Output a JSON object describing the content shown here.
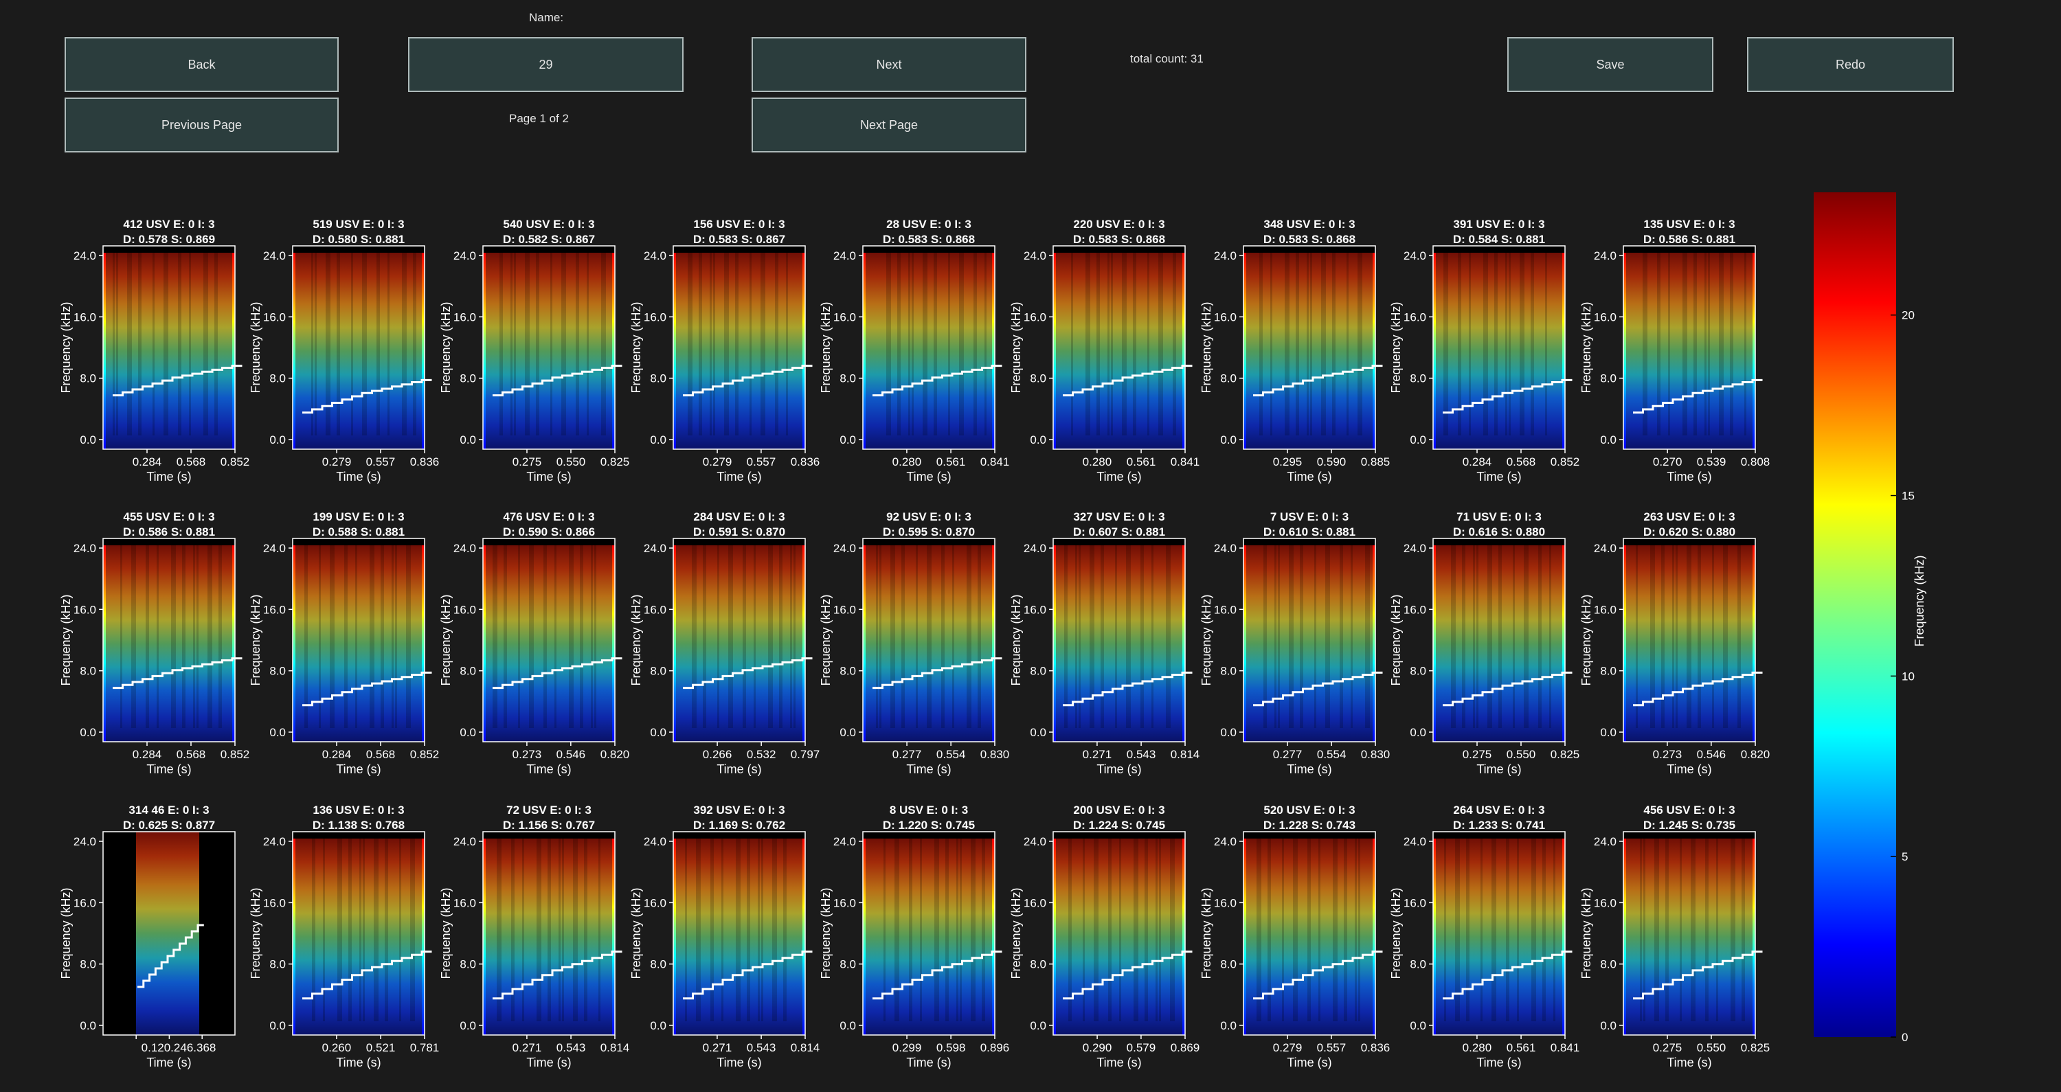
{
  "toolbar": {
    "back_label": "Back",
    "name_label": "Name:",
    "name_value": "29",
    "next_label": "Next",
    "total_count": "total count: 31",
    "save_label": "Save",
    "redo_label": "Redo",
    "prev_page_label": "Previous Page",
    "page_indicator": "Page 1 of 2",
    "next_page_label": "Next Page"
  },
  "axis_text": {
    "ylabel": "Frequency (kHz)",
    "xlabel": "Time (s)"
  },
  "colorbar": {
    "label": "Frequency (kHz)",
    "ticks": [
      "0",
      "5",
      "10",
      "15",
      "20"
    ],
    "range": [
      0,
      23.4
    ]
  },
  "chart_data": [
    {
      "type": "heatmap",
      "title1": "412 USV E: 0 I: 3",
      "title2": "D: 0.578  S: 0.869",
      "yticks": [
        "0.0",
        "8.0",
        "16.0",
        "24.0"
      ],
      "xticks": [
        "0.284",
        "0.568",
        "0.852"
      ],
      "xmax": 0.852
    },
    {
      "type": "heatmap",
      "title1": "519 USV E: 0 I: 3",
      "title2": "D: 0.580  S: 0.881",
      "yticks": [
        "0.0",
        "8.0",
        "16.0",
        "24.0"
      ],
      "xticks": [
        "0.279",
        "0.557",
        "0.836"
      ],
      "xmax": 0.836
    },
    {
      "type": "heatmap",
      "title1": "540 USV E: 0 I: 3",
      "title2": "D: 0.582  S: 0.867",
      "yticks": [
        "0.0",
        "8.0",
        "16.0",
        "24.0"
      ],
      "xticks": [
        "0.275",
        "0.550",
        "0.825"
      ],
      "xmax": 0.825
    },
    {
      "type": "heatmap",
      "title1": "156 USV E: 0 I: 3",
      "title2": "D: 0.583  S: 0.867",
      "yticks": [
        "0.0",
        "8.0",
        "16.0",
        "24.0"
      ],
      "xticks": [
        "0.279",
        "0.557",
        "0.836"
      ],
      "xmax": 0.836
    },
    {
      "type": "heatmap",
      "title1": "28 USV E: 0 I: 3",
      "title2": "D: 0.583  S: 0.868",
      "yticks": [
        "0.0",
        "8.0",
        "16.0",
        "24.0"
      ],
      "xticks": [
        "0.280",
        "0.561",
        "0.841"
      ],
      "xmax": 0.841
    },
    {
      "type": "heatmap",
      "title1": "220 USV E: 0 I: 3",
      "title2": "D: 0.583  S: 0.868",
      "yticks": [
        "0.0",
        "8.0",
        "16.0",
        "24.0"
      ],
      "xticks": [
        "0.280",
        "0.561",
        "0.841"
      ],
      "xmax": 0.841
    },
    {
      "type": "heatmap",
      "title1": "348 USV E: 0 I: 3",
      "title2": "D: 0.583  S: 0.868",
      "yticks": [
        "0.0",
        "8.0",
        "16.0",
        "24.0"
      ],
      "xticks": [
        "0.295",
        "0.590",
        "0.885"
      ],
      "xmax": 0.885
    },
    {
      "type": "heatmap",
      "title1": "391 USV E: 0 I: 3",
      "title2": "D: 0.584  S: 0.881",
      "yticks": [
        "0.0",
        "8.0",
        "16.0",
        "24.0"
      ],
      "xticks": [
        "0.284",
        "0.568",
        "0.852"
      ],
      "xmax": 0.852
    },
    {
      "type": "heatmap",
      "title1": "135 USV E: 0 I: 3",
      "title2": "D: 0.586  S: 0.881",
      "yticks": [
        "0.0",
        "8.0",
        "16.0",
        "24.0"
      ],
      "xticks": [
        "0.270",
        "0.539",
        "0.808"
      ],
      "xmax": 0.808
    },
    {
      "type": "heatmap",
      "title1": "455 USV E: 0 I: 3",
      "title2": "D: 0.586  S: 0.881",
      "yticks": [
        "0.0",
        "8.0",
        "16.0",
        "24.0"
      ],
      "xticks": [
        "0.284",
        "0.568",
        "0.852"
      ],
      "xmax": 0.852
    },
    {
      "type": "heatmap",
      "title1": "199 USV E: 0 I: 3",
      "title2": "D: 0.588  S: 0.881",
      "yticks": [
        "0.0",
        "8.0",
        "16.0",
        "24.0"
      ],
      "xticks": [
        "0.284",
        "0.568",
        "0.852"
      ],
      "xmax": 0.852
    },
    {
      "type": "heatmap",
      "title1": "476 USV E: 0 I: 3",
      "title2": "D: 0.590  S: 0.866",
      "yticks": [
        "0.0",
        "8.0",
        "16.0",
        "24.0"
      ],
      "xticks": [
        "0.273",
        "0.546",
        "0.820"
      ],
      "xmax": 0.82
    },
    {
      "type": "heatmap",
      "title1": "284 USV E: 0 I: 3",
      "title2": "D: 0.591  S: 0.870",
      "yticks": [
        "0.0",
        "8.0",
        "16.0",
        "24.0"
      ],
      "xticks": [
        "0.266",
        "0.532",
        "0.797"
      ],
      "xmax": 0.797
    },
    {
      "type": "heatmap",
      "title1": "92 USV E: 0 I: 3",
      "title2": "D: 0.595  S: 0.870",
      "yticks": [
        "0.0",
        "8.0",
        "16.0",
        "24.0"
      ],
      "xticks": [
        "0.277",
        "0.554",
        "0.830"
      ],
      "xmax": 0.83
    },
    {
      "type": "heatmap",
      "title1": "327 USV E: 0 I: 3",
      "title2": "D: 0.607  S: 0.881",
      "yticks": [
        "0.0",
        "8.0",
        "16.0",
        "24.0"
      ],
      "xticks": [
        "0.271",
        "0.543",
        "0.814"
      ],
      "xmax": 0.814
    },
    {
      "type": "heatmap",
      "title1": "7 USV E: 0 I: 3",
      "title2": "D: 0.610  S: 0.881",
      "yticks": [
        "0.0",
        "8.0",
        "16.0",
        "24.0"
      ],
      "xticks": [
        "0.277",
        "0.554",
        "0.830"
      ],
      "xmax": 0.83
    },
    {
      "type": "heatmap",
      "title1": "71 USV E: 0 I: 3",
      "title2": "D: 0.616  S: 0.880",
      "yticks": [
        "0.0",
        "8.0",
        "16.0",
        "24.0"
      ],
      "xticks": [
        "0.275",
        "0.550",
        "0.825"
      ],
      "xmax": 0.825
    },
    {
      "type": "heatmap",
      "title1": "263 USV E: 0 I: 3",
      "title2": "D: 0.620  S: 0.880",
      "yticks": [
        "0.0",
        "8.0",
        "16.0",
        "24.0"
      ],
      "xticks": [
        "0.273",
        "0.546",
        "0.820"
      ],
      "xmax": 0.82
    },
    {
      "type": "heatmap",
      "title1": "314 46 E: 0 I: 3",
      "title2": "D: 0.625  S: 0.877",
      "yticks": [
        "0.0",
        "8.0",
        "16.0",
        "24.0"
      ],
      "xticks": [
        "0.123",
        "0.246",
        "0.368"
      ],
      "xmax": 0.368,
      "tick_text": "0.120.246.368"
    },
    {
      "type": "heatmap",
      "title1": "136 USV E: 0 I: 3",
      "title2": "D: 1.138  S: 0.768",
      "yticks": [
        "0.0",
        "8.0",
        "16.0",
        "24.0"
      ],
      "xticks": [
        "0.260",
        "0.521",
        "0.781"
      ],
      "xmax": 0.781
    },
    {
      "type": "heatmap",
      "title1": "72 USV E: 0 I: 3",
      "title2": "D: 1.156  S: 0.767",
      "yticks": [
        "0.0",
        "8.0",
        "16.0",
        "24.0"
      ],
      "xticks": [
        "0.271",
        "0.543",
        "0.814"
      ],
      "xmax": 0.814
    },
    {
      "type": "heatmap",
      "title1": "392 USV E: 0 I: 3",
      "title2": "D: 1.169  S: 0.762",
      "yticks": [
        "0.0",
        "8.0",
        "16.0",
        "24.0"
      ],
      "xticks": [
        "0.271",
        "0.543",
        "0.814"
      ],
      "xmax": 0.814
    },
    {
      "type": "heatmap",
      "title1": "8 USV E: 0 I: 3",
      "title2": "D: 1.220  S: 0.745",
      "yticks": [
        "0.0",
        "8.0",
        "16.0",
        "24.0"
      ],
      "xticks": [
        "0.299",
        "0.598",
        "0.896"
      ],
      "xmax": 0.896
    },
    {
      "type": "heatmap",
      "title1": "200 USV E: 0 I: 3",
      "title2": "D: 1.224  S: 0.745",
      "yticks": [
        "0.0",
        "8.0",
        "16.0",
        "24.0"
      ],
      "xticks": [
        "0.290",
        "0.579",
        "0.869"
      ],
      "xmax": 0.869
    },
    {
      "type": "heatmap",
      "title1": "520 USV E: 0 I: 3",
      "title2": "D: 1.228  S: 0.743",
      "yticks": [
        "0.0",
        "8.0",
        "16.0",
        "24.0"
      ],
      "xticks": [
        "0.279",
        "0.557",
        "0.836"
      ],
      "xmax": 0.836
    },
    {
      "type": "heatmap",
      "title1": "264 USV E: 0 I: 3",
      "title2": "D: 1.233  S: 0.741",
      "yticks": [
        "0.0",
        "8.0",
        "16.0",
        "24.0"
      ],
      "xticks": [
        "0.280",
        "0.561",
        "0.841"
      ],
      "xmax": 0.841
    },
    {
      "type": "heatmap",
      "title1": "456 USV E: 0 I: 3",
      "title2": "D: 1.245  S: 0.735",
      "yticks": [
        "0.0",
        "8.0",
        "16.0",
        "24.0"
      ],
      "xticks": [
        "0.275",
        "0.550",
        "0.825"
      ],
      "xmax": 0.825
    }
  ]
}
